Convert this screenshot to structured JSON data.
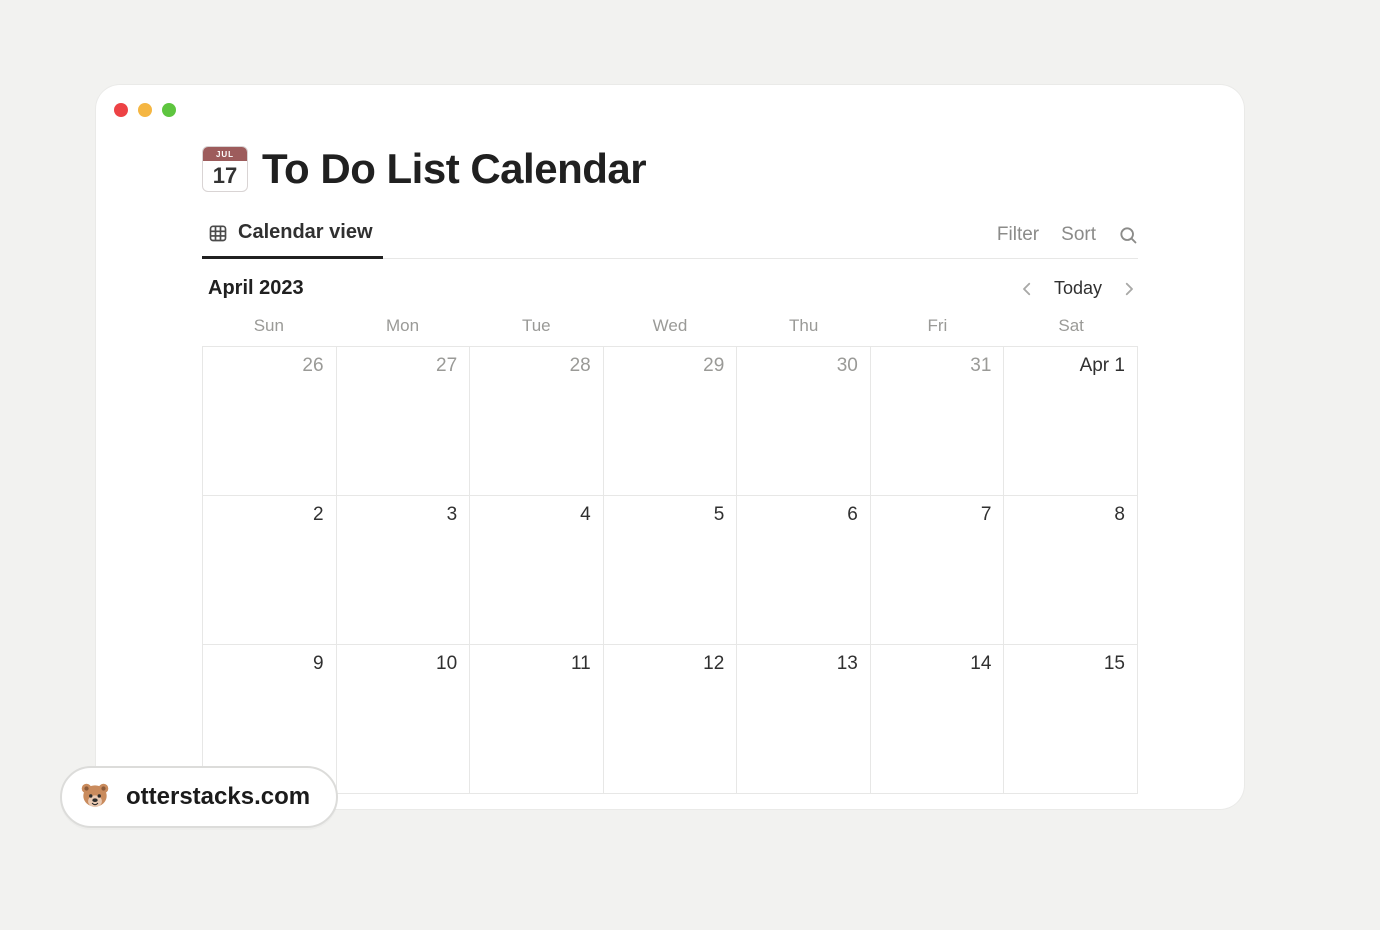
{
  "page": {
    "emoji_month": "JUL",
    "emoji_day": "17",
    "title": "To Do List Calendar"
  },
  "tab": {
    "label": "Calendar view"
  },
  "actions": {
    "filter": "Filter",
    "sort": "Sort"
  },
  "month": {
    "label": "April 2023",
    "today": "Today"
  },
  "dow": [
    "Sun",
    "Mon",
    "Tue",
    "Wed",
    "Thu",
    "Fri",
    "Sat"
  ],
  "weeks": [
    [
      {
        "label": "26",
        "in_month": false
      },
      {
        "label": "27",
        "in_month": false
      },
      {
        "label": "28",
        "in_month": false
      },
      {
        "label": "29",
        "in_month": false
      },
      {
        "label": "30",
        "in_month": false
      },
      {
        "label": "31",
        "in_month": false
      },
      {
        "label": "Apr 1",
        "in_month": true,
        "first": true
      }
    ],
    [
      {
        "label": "2",
        "in_month": true
      },
      {
        "label": "3",
        "in_month": true
      },
      {
        "label": "4",
        "in_month": true
      },
      {
        "label": "5",
        "in_month": true
      },
      {
        "label": "6",
        "in_month": true
      },
      {
        "label": "7",
        "in_month": true
      },
      {
        "label": "8",
        "in_month": true
      }
    ],
    [
      {
        "label": "9",
        "in_month": true
      },
      {
        "label": "10",
        "in_month": true
      },
      {
        "label": "11",
        "in_month": true
      },
      {
        "label": "12",
        "in_month": true
      },
      {
        "label": "13",
        "in_month": true
      },
      {
        "label": "14",
        "in_month": true
      },
      {
        "label": "15",
        "in_month": true
      }
    ]
  ],
  "badge": {
    "text": "otterstacks.com"
  }
}
